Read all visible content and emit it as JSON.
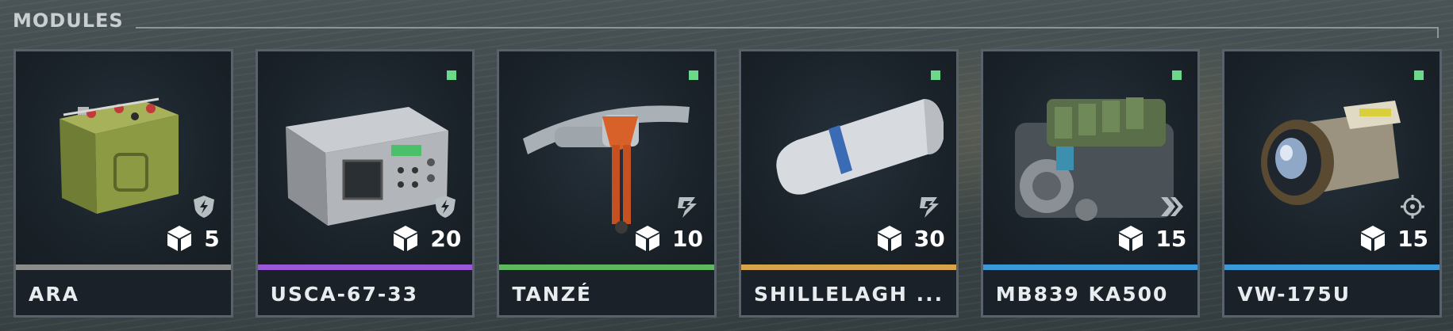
{
  "header": {
    "title": "MODULES"
  },
  "modules": [
    {
      "name": "ARA",
      "cost": "5",
      "rarity_color": "#8c8c8c",
      "type_icon": "shield-bolt-icon",
      "status": false
    },
    {
      "name": "USCA-67-33",
      "cost": "20",
      "rarity_color": "#9a58d6",
      "type_icon": "shield-bolt-icon",
      "status": true
    },
    {
      "name": "TANZÉ",
      "cost": "10",
      "rarity_color": "#5fb85f",
      "type_icon": "bolt-arrows-icon",
      "status": true
    },
    {
      "name": "SHILLELAGH ...",
      "cost": "30",
      "rarity_color": "#d7a44c",
      "type_icon": "bolt-arrows-icon",
      "status": true
    },
    {
      "name": "MB839 KA500",
      "cost": "15",
      "rarity_color": "#3a9ad8",
      "type_icon": "double-chevron-icon",
      "status": true
    },
    {
      "name": "VW-175U",
      "cost": "15",
      "rarity_color": "#3a9ad8",
      "type_icon": "crosshair-icon",
      "status": true
    }
  ],
  "colors": {
    "status_green": "#6cd88a",
    "card_border": "#59626a",
    "card_bg": "#1a2128"
  }
}
